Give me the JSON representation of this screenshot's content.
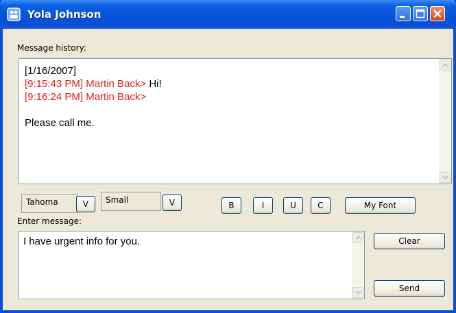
{
  "window": {
    "title": "Yola Johnson"
  },
  "history": {
    "label": "Message history:",
    "date": "[1/16/2007]",
    "messages": [
      {
        "stamp": "[9:15:43 PM] Martin Back>",
        "text": " Hi!"
      },
      {
        "stamp": "[9:16:24 PM] Martin Back>",
        "text": ""
      }
    ],
    "body": "Please call me."
  },
  "toolbar": {
    "font_name": "Tahoma",
    "font_size": "Small",
    "font_dropdown": "V",
    "size_dropdown": "V",
    "bold": "B",
    "italic": "I",
    "underline": "U",
    "color": "C",
    "my_font": "My Font"
  },
  "compose": {
    "label": "Enter message:",
    "value": "I have urgent info for you.",
    "clear": "Clear",
    "send": "Send"
  },
  "colors": {
    "title_bar": "#0a4fd8",
    "message_stamp": "#e02020",
    "window_bg": "#ece9d8"
  }
}
